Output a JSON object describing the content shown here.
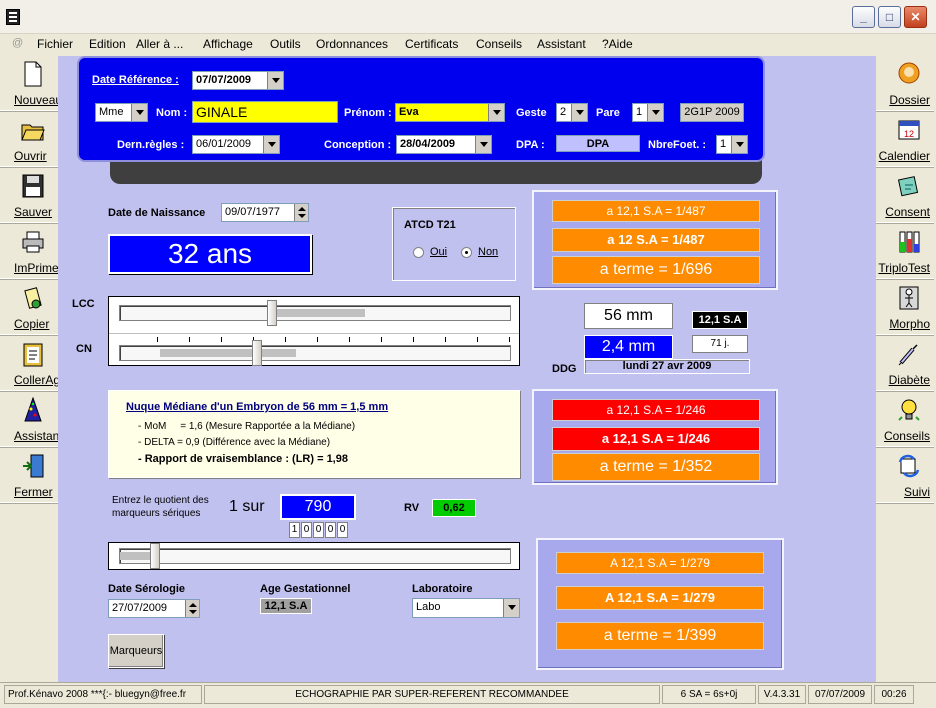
{
  "menu": [
    "Fichier",
    "Edition",
    "Aller à ...",
    "Affichage",
    "Outils",
    "Ordonnances",
    "Certificats",
    "Conseils",
    "Assistant",
    "?Aide"
  ],
  "left_toolbar": [
    "Nouveau",
    "Ouvrir",
    "Sauver",
    "ImPrimer",
    "Copier",
    "CollerAg",
    "Assistant",
    "Fermer"
  ],
  "right_toolbar": [
    "Dossier",
    "Calendier",
    "Consent",
    "TriploTest",
    "Morpho",
    "Diabète",
    "Conseils",
    "Suivi"
  ],
  "header": {
    "date_ref_label": "Date Référence :",
    "date_ref_value": "07/07/2009",
    "civilite": "Mme",
    "nom_label": "Nom :",
    "nom_value": "GINALE",
    "prenom_label": "Prénom :",
    "prenom_value": "Eva",
    "geste_label": "Geste",
    "geste_value": "2",
    "pare_label": "Pare",
    "pare_value": "1",
    "code": "2G1P 2009",
    "dern_regles_label": "Dern.règles :",
    "dern_regles_value": "06/01/2009",
    "conception_label": "Conception :",
    "conception_value": "28/04/2009",
    "dpa_label": "DPA :",
    "dpa_value": "DPA",
    "nbrefoet_label": "NbreFoet. :",
    "nbrefoet_value": "1"
  },
  "birth": {
    "label": "Date de Naissance",
    "value": "09/07/1977"
  },
  "age": "32 ans",
  "atcd": {
    "title": "ATCD T21",
    "oui": "Oui",
    "non": "Non",
    "selected": "non"
  },
  "sliders": {
    "lcc_label": "LCC",
    "cn_label": "CN",
    "lcc_position": 0.39,
    "cn_position": 0.35,
    "serum_position": 0.09
  },
  "measures": {
    "lcc": "56 mm",
    "cn": "2,4 mm",
    "sa": "12,1 S.A",
    "days": "71 j.",
    "ddg_label": "DDG",
    "ddg_value": "lundi 27 avr 2009"
  },
  "risk_box_1": [
    "a 12,1 S.A = 1/487",
    "a 12 S.A = 1/487",
    "a terme = 1/696"
  ],
  "info": {
    "title": "Nuque Médiane d'un Embryon de 56 mm = 1,5 mm",
    "line1": "- MoM     = 1,6 (Mesure Rapportée a la Médiane)",
    "line2": "- DELTA = 0,9 (Différence avec la Médiane)",
    "line3": "- Rapport de vraisemblance : (LR) = 1,98"
  },
  "risk_box_2": [
    "a 12,1 S.A = 1/246",
    "a 12,1 S.A = 1/246",
    "a terme = 1/352"
  ],
  "quotient": {
    "label_line1": "Entrez le quotient des",
    "label_line2": "marqueurs sériques",
    "one_on": "1 sur",
    "value": "790",
    "digits": [
      "1",
      "0",
      "0",
      "0",
      "0"
    ],
    "rv_label": "RV",
    "rv_value": "0,62"
  },
  "serology": {
    "date_label": "Date Sérologie",
    "date_value": "27/07/2009",
    "age_label": "Age Gestationnel",
    "age_value": "12,1 S.A",
    "lab_label": "Laboratoire",
    "lab_value": "Labo",
    "markers_button": "Marqueurs"
  },
  "risk_box_3": [
    "A 12,1 S.A = 1/279",
    "A 12,1 S.A = 1/279",
    "a terme = 1/399"
  ],
  "status": {
    "author": "Prof.Kénavo 2008 ***{:- bluegyn@free.fr",
    "message": "ECHOGRAPHIE PAR SUPER-REFERENT RECOMMANDEE",
    "sa": "6 SA = 6s+0j",
    "version": "V.4.3.31",
    "date": "07/07/2009",
    "time": "00:26"
  },
  "colors": {
    "header_blue": "#0000ee",
    "main_bg": "#c1c1f0",
    "orange": "#ff8b00",
    "red": "#ff0000",
    "yellow_field": "#ffff00",
    "green_rv": "#00cc00"
  }
}
